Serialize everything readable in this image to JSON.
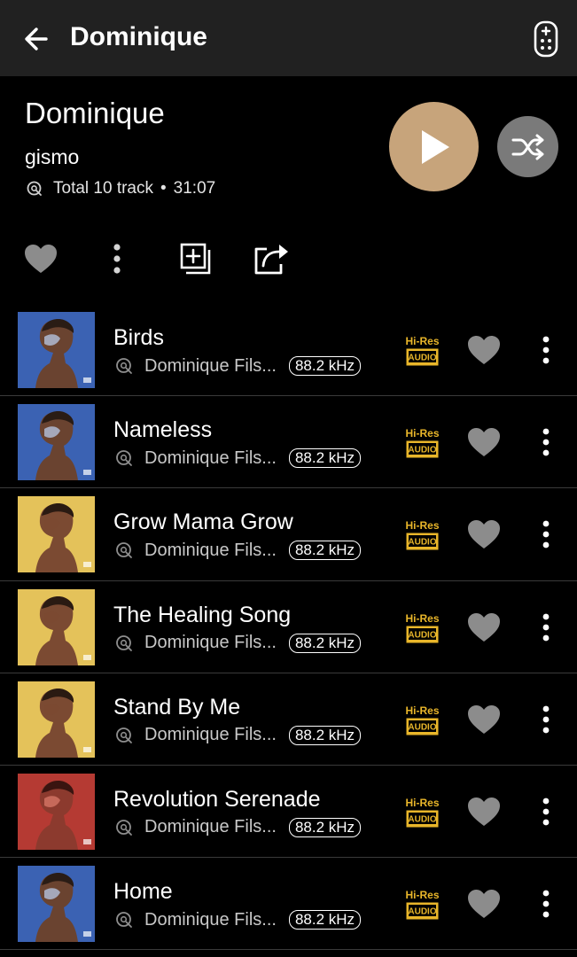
{
  "header": {
    "title": "Dominique"
  },
  "album": {
    "title": "Dominique",
    "artist": "gismo",
    "track_count_label": "Total 10 track",
    "separator": "•",
    "duration": "31:07"
  },
  "colors": {
    "play_button": "#c7a47b",
    "shuffle_button": "#7a7a7a",
    "top_bar": "#212121",
    "background": "#000000",
    "hires_gold": "#e9b62a"
  },
  "actions": {
    "favorite_icon": "heart-icon",
    "more_icon": "more-vertical-icon",
    "add_icon": "add-to-playlist-icon",
    "share_icon": "share-icon"
  },
  "tracks": [
    {
      "title": "Birds",
      "artist": "Dominique Fils...",
      "quality": "88.2 kHz",
      "badge_top": "Hi-Res",
      "badge_bottom": "AUDIO",
      "cover": "blue"
    },
    {
      "title": "Nameless",
      "artist": "Dominique Fils...",
      "quality": "88.2 kHz",
      "badge_top": "Hi-Res",
      "badge_bottom": "AUDIO",
      "cover": "blue"
    },
    {
      "title": "Grow Mama Grow",
      "artist": "Dominique Fils...",
      "quality": "88.2 kHz",
      "badge_top": "Hi-Res",
      "badge_bottom": "AUDIO",
      "cover": "yellow"
    },
    {
      "title": "The Healing Song",
      "artist": "Dominique Fils...",
      "quality": "88.2 kHz",
      "badge_top": "Hi-Res",
      "badge_bottom": "AUDIO",
      "cover": "yellow"
    },
    {
      "title": "Stand By Me",
      "artist": "Dominique Fils...",
      "quality": "88.2 kHz",
      "badge_top": "Hi-Res",
      "badge_bottom": "AUDIO",
      "cover": "yellow"
    },
    {
      "title": "Revolution Serenade",
      "artist": "Dominique Fils...",
      "quality": "88.2 kHz",
      "badge_top": "Hi-Res",
      "badge_bottom": "AUDIO",
      "cover": "red"
    },
    {
      "title": "Home",
      "artist": "Dominique Fils...",
      "quality": "88.2 kHz",
      "badge_top": "Hi-Res",
      "badge_bottom": "AUDIO",
      "cover": "blue"
    }
  ]
}
